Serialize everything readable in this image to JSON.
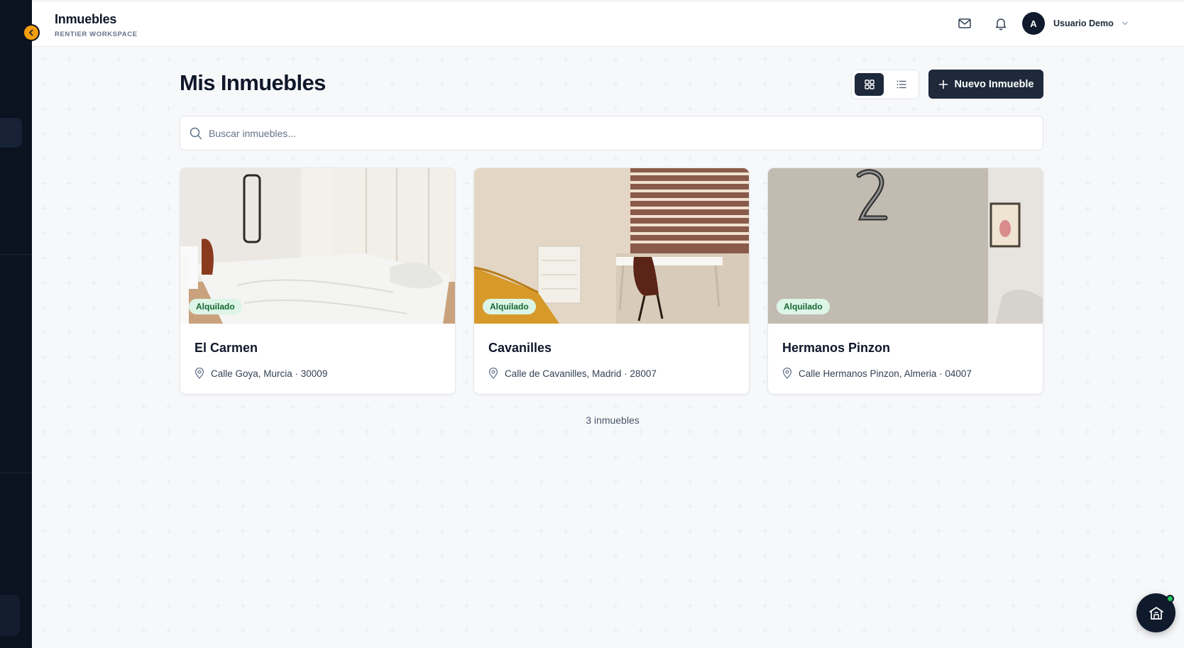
{
  "header": {
    "title": "Inmuebles",
    "subtitle": "RENTIER WORKSPACE",
    "user": {
      "initial": "A",
      "name": "Usuario Demo"
    }
  },
  "icons": {
    "collapse": "chevron-left-icon",
    "mail": "mail-icon",
    "bell": "bell-icon",
    "user_menu": "chevron-down-icon",
    "grid_view": "grid-icon",
    "list_view": "list-icon",
    "add": "plus-icon",
    "search": "search-icon",
    "location": "map-pin-icon",
    "fab": "building-icon"
  },
  "colors": {
    "sidebar": "#0b1220",
    "accent": "#f59e0b",
    "primary": "#1e293b",
    "badge_bg": "#dcf5e6",
    "badge_text": "#166534",
    "online": "#22c55e"
  },
  "main": {
    "page_title": "Mis Inmuebles",
    "view_mode": "grid",
    "new_button_label": "Nuevo Inmueble",
    "search_placeholder": "Buscar inmuebles...",
    "properties": [
      {
        "name": "El Carmen",
        "address": "Calle Goya, Murcia · 30009",
        "status": "Alquilado"
      },
      {
        "name": "Cavanilles",
        "address": "Calle de Cavanilles, Madrid · 28007",
        "status": "Alquilado"
      },
      {
        "name": "Hermanos Pinzon",
        "address": "Calle Hermanos Pinzon, Almeria · 04007",
        "status": "Alquilado"
      }
    ],
    "count_label": "3 inmuebles"
  }
}
